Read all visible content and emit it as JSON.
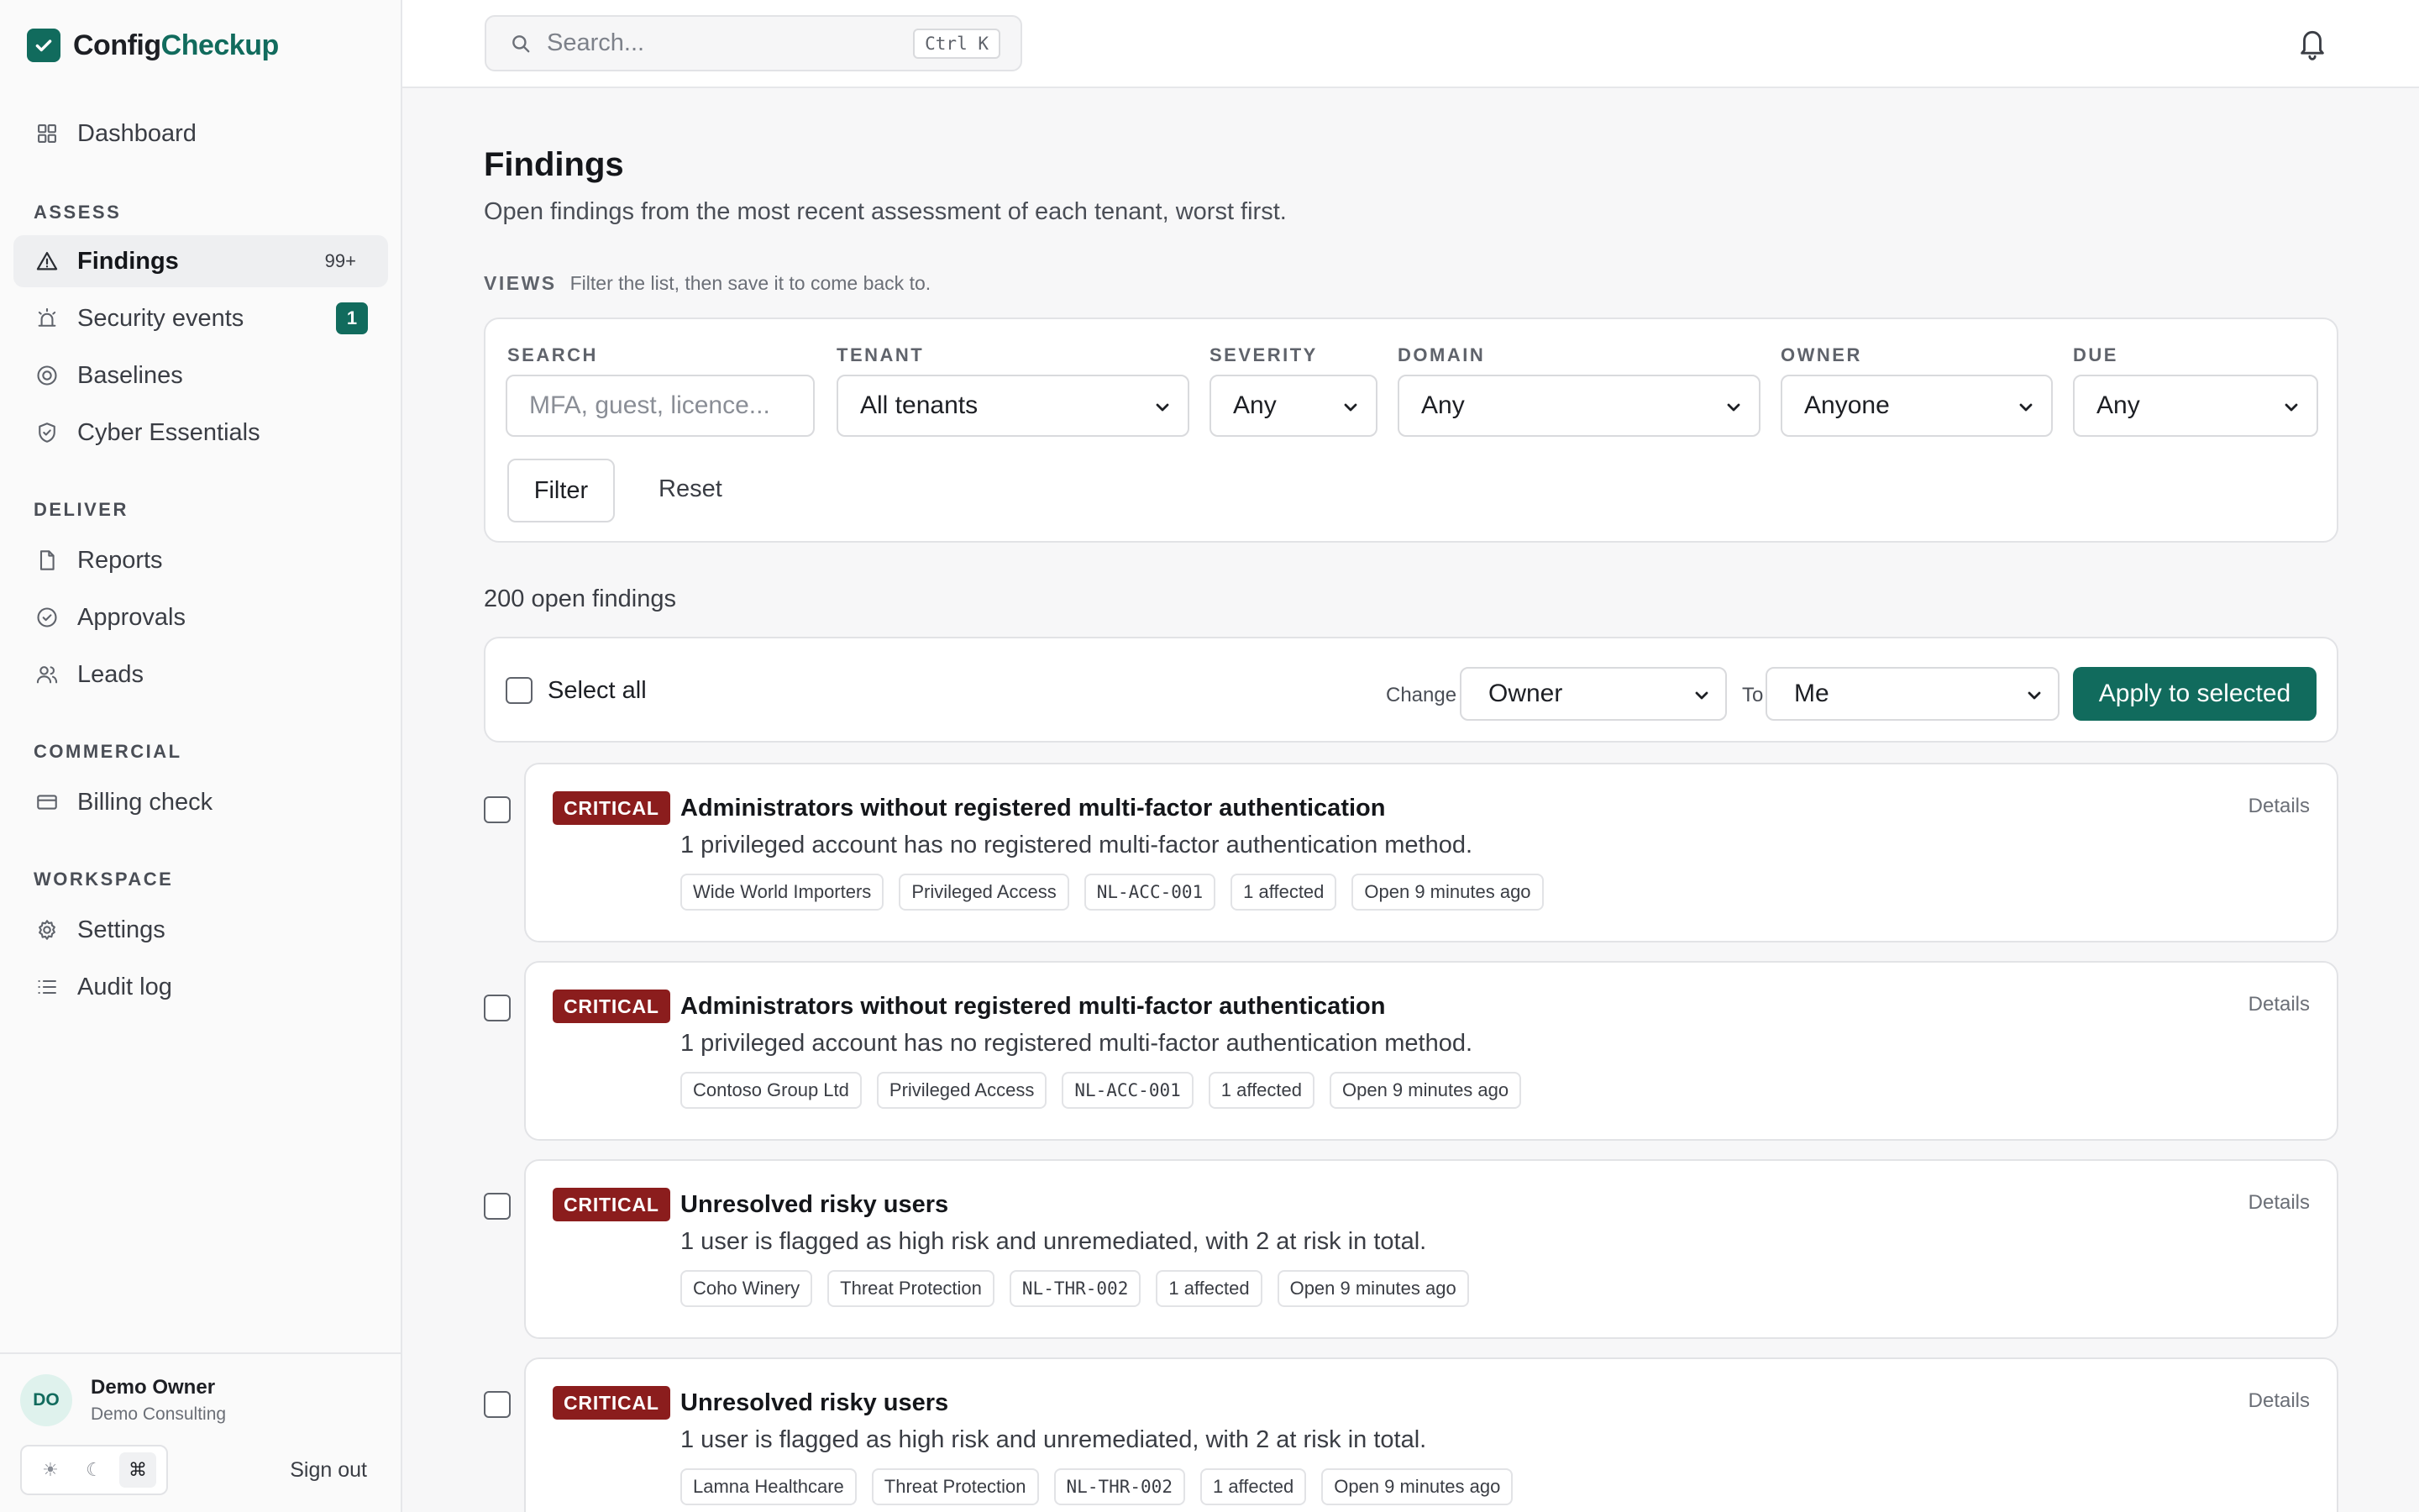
{
  "app": {
    "name_prefix": "Config",
    "name_suffix": "Checkup",
    "brand_color": "#116b5d",
    "logo_icon": "checkmark-icon"
  },
  "sidebar": {
    "dashboard": {
      "label": "Dashboard",
      "icon": "grid-icon"
    },
    "sections": {
      "assess": "ASSESS",
      "deliver": "DELIVER",
      "commercial": "COMMERCIAL",
      "workspace": "WORKSPACE"
    },
    "assess_items": [
      {
        "label": "Findings",
        "count": "99+",
        "icon": "warning-triangle-icon",
        "active": true
      },
      {
        "label": "Security events",
        "badge": "1",
        "icon": "alarm-icon"
      },
      {
        "label": "Baselines",
        "icon": "target-icon"
      },
      {
        "label": "Cyber Essentials",
        "icon": "shield-check-icon"
      }
    ],
    "deliver_items": [
      {
        "label": "Reports",
        "icon": "document-icon"
      },
      {
        "label": "Approvals",
        "icon": "check-circle-icon"
      },
      {
        "label": "Leads",
        "icon": "users-icon"
      }
    ],
    "commercial_items": [
      {
        "label": "Billing check",
        "icon": "credit-card-icon"
      }
    ],
    "workspace_items": [
      {
        "label": "Settings",
        "icon": "gear-icon"
      },
      {
        "label": "Audit log",
        "icon": "list-icon"
      }
    ],
    "user": {
      "initials": "DO",
      "name": "Demo Owner",
      "org": "Demo Consulting",
      "sign_out": "Sign out"
    },
    "theme_options": [
      "☀",
      "☾",
      "⌘"
    ]
  },
  "topbar": {
    "search_placeholder": "Search...",
    "shortcut": "Ctrl K",
    "bell_icon": "bell-icon"
  },
  "page": {
    "title": "Findings",
    "subtitle": "Open findings from the most recent assessment of each tenant, worst first.",
    "views_tag": "VIEWS",
    "views_hint": "Filter the list, then save it to come back to."
  },
  "filters": {
    "search": {
      "label": "SEARCH",
      "placeholder": "MFA, guest, licence..."
    },
    "tenant": {
      "label": "TENANT",
      "value": "All tenants"
    },
    "severity": {
      "label": "SEVERITY",
      "value": "Any"
    },
    "domain": {
      "label": "DOMAIN",
      "value": "Any"
    },
    "owner": {
      "label": "OWNER",
      "value": "Anyone"
    },
    "due": {
      "label": "DUE",
      "value": "Any"
    },
    "filter_button": "Filter",
    "reset_button": "Reset"
  },
  "results": {
    "count_text": "200 open findings"
  },
  "bulk": {
    "select_all": "Select all",
    "change_label": "Change",
    "change_value": "Owner",
    "to_label": "To",
    "to_value": "Me",
    "apply": "Apply to selected"
  },
  "findings": [
    {
      "severity": "CRITICAL",
      "title": "Administrators without registered multi-factor authentication",
      "description": "1 privileged account has no registered multi-factor authentication method.",
      "tenant": "Wide World Importers",
      "domain": "Privileged Access",
      "code": "NL-ACC-001",
      "affected": "1 affected",
      "age": "Open 9 minutes ago",
      "details": "Details"
    },
    {
      "severity": "CRITICAL",
      "title": "Administrators without registered multi-factor authentication",
      "description": "1 privileged account has no registered multi-factor authentication method.",
      "tenant": "Contoso Group Ltd",
      "domain": "Privileged Access",
      "code": "NL-ACC-001",
      "affected": "1 affected",
      "age": "Open 9 minutes ago",
      "details": "Details"
    },
    {
      "severity": "CRITICAL",
      "title": "Unresolved risky users",
      "description": "1 user is flagged as high risk and unremediated, with 2 at risk in total.",
      "tenant": "Coho Winery",
      "domain": "Threat Protection",
      "code": "NL-THR-002",
      "affected": "1 affected",
      "age": "Open 9 minutes ago",
      "details": "Details"
    },
    {
      "severity": "CRITICAL",
      "title": "Unresolved risky users",
      "description": "1 user is flagged as high risk and unremediated, with 2 at risk in total.",
      "tenant": "Lamna Healthcare",
      "domain": "Threat Protection",
      "code": "NL-THR-002",
      "affected": "1 affected",
      "age": "Open 9 minutes ago",
      "details": "Details"
    }
  ],
  "colors": {
    "critical": "#8b1d1d",
    "accent": "#116b5d"
  }
}
